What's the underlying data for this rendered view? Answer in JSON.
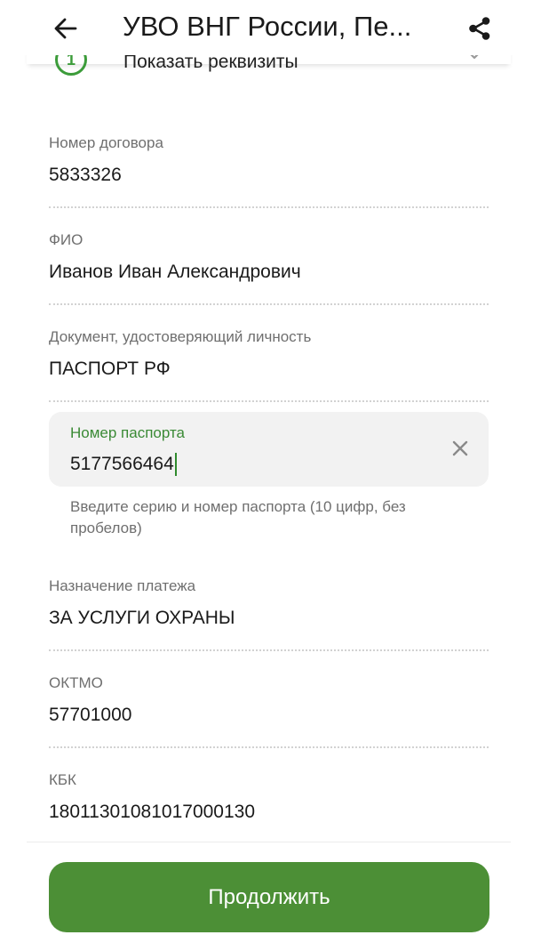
{
  "header": {
    "title": "УВО ВНГ России, Пе..."
  },
  "requisites": {
    "step": "1",
    "label": "Показать реквизиты"
  },
  "fields": {
    "contract": {
      "label": "Номер договора",
      "value": "5833326"
    },
    "fio": {
      "label": "ФИО",
      "value": "Иванов Иван Александрович"
    },
    "document": {
      "label": "Документ, удостоверяющий личность",
      "value": "ПАСПОРТ РФ"
    },
    "purpose": {
      "label": "Назначение платежа",
      "value": "ЗА УСЛУГИ ОХРАНЫ"
    },
    "oktmo": {
      "label": "ОКТМО",
      "value": "57701000"
    },
    "kbk": {
      "label": "КБК",
      "value": "18011301081017000130"
    }
  },
  "passport": {
    "label": "Номер паспорта",
    "value": "5177566464",
    "helper": "Введите серию и номер паспорта (10 цифр, без пробелов)"
  },
  "continue_label": "Продолжить",
  "icons": {
    "back": "arrow-back-icon",
    "share": "share-icon",
    "clear": "close-icon",
    "expand": "chevron-down-icon"
  },
  "colors": {
    "accent": "#3c9c3a",
    "button": "#4c8f36",
    "label": "#6f6f6f",
    "input_bg": "#f2f2f2"
  }
}
